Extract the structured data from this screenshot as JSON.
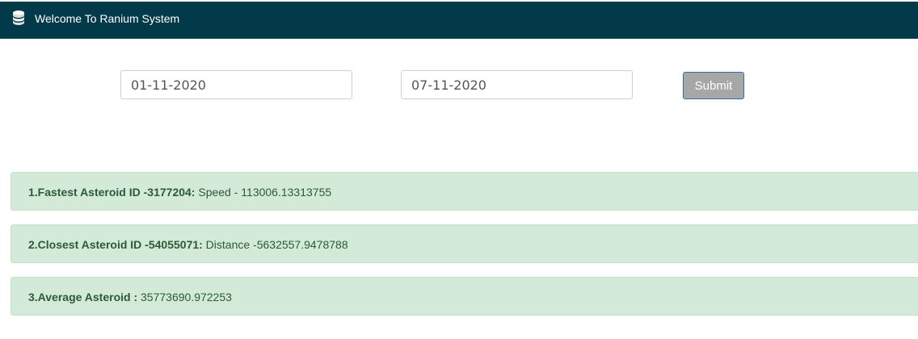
{
  "header": {
    "title": "Welcome To Ranium System",
    "icon": "database-icon",
    "background": "#033a4a"
  },
  "form": {
    "from_date": "01-11-2020",
    "to_date": "07-11-2020",
    "submit_label": "Submit"
  },
  "results": [
    {
      "label": "1.Fastest Asteroid ID -3177204:",
      "value": " Speed - 113006.13313755"
    },
    {
      "label": "2.Closest Asteroid ID -54055071:",
      "value": " Distance -5632557.9478788"
    },
    {
      "label": "3.Average Asteroid :",
      "value": " 35773690.972253"
    }
  ],
  "colors": {
    "result_background": "#d4ead9",
    "result_text": "#2b5b36",
    "submit_background": "#a7a7a7"
  }
}
